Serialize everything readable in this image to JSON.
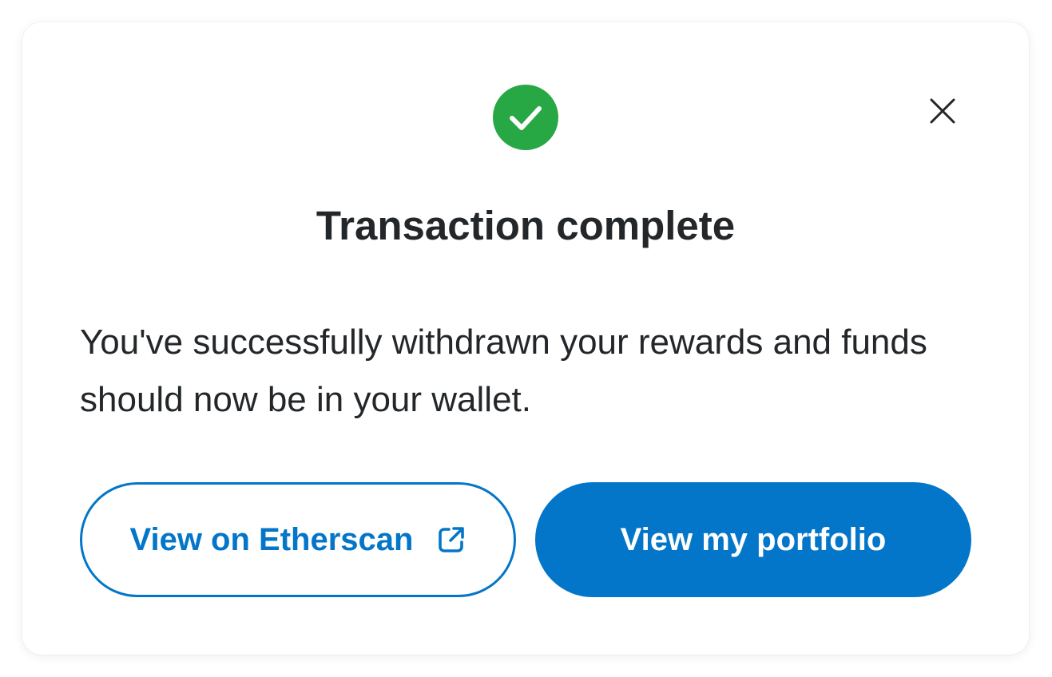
{
  "modal": {
    "title": "Transaction complete",
    "message": "You've successfully withdrawn your rewards and funds should now be in your wallet.",
    "icons": {
      "status": "check-circle-icon",
      "close": "close-icon",
      "external": "external-link-icon"
    },
    "buttons": {
      "etherscan_label": "View on Etherscan",
      "portfolio_label": "View my portfolio"
    }
  },
  "colors": {
    "success": "#28a745",
    "primary": "#0376c9",
    "text": "#24272a",
    "background": "#ffffff"
  }
}
